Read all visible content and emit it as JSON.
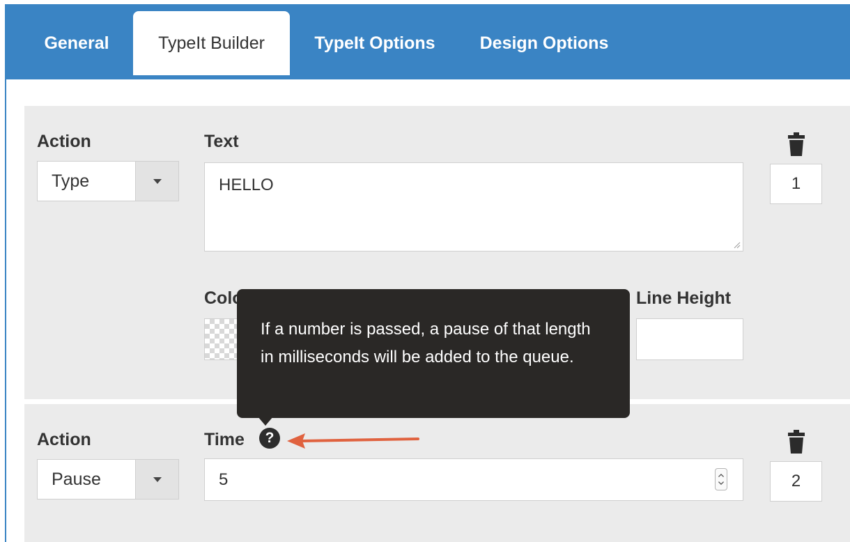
{
  "tabs": [
    {
      "label": "General",
      "active": false
    },
    {
      "label": "TypeIt Builder",
      "active": true
    },
    {
      "label": "TypeIt Options",
      "active": false
    },
    {
      "label": "Design Options",
      "active": false
    }
  ],
  "step1": {
    "action_label": "Action",
    "action_value": "Type",
    "text_label": "Text",
    "text_value": "HELLO",
    "color_label": "Colo",
    "line_height_label": "Line Height",
    "order": "1"
  },
  "step2": {
    "action_label": "Action",
    "action_value": "Pause",
    "time_label": "Time",
    "time_value": "5",
    "order": "2"
  },
  "tooltip": {
    "text": "If a number is passed, a pause of that length in milliseconds will be added to the queue."
  },
  "colors": {
    "tab_bar": "#3a84c4",
    "panel": "#ebebeb",
    "tooltip_bg": "#2a2826",
    "annotation_arrow": "#e0623f"
  }
}
